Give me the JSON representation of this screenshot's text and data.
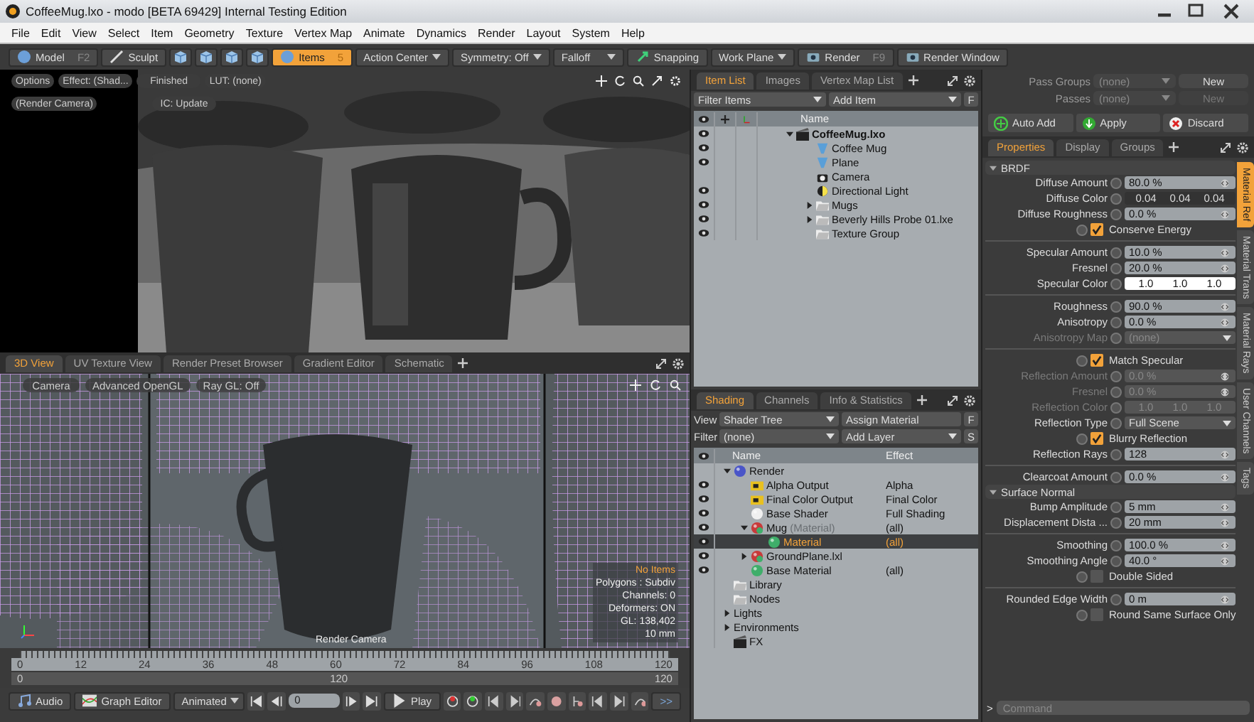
{
  "window": {
    "title": "CoffeeMug.lxo - modo [BETA 69429] Internal Testing Edition"
  },
  "menu": [
    "File",
    "Edit",
    "View",
    "Select",
    "Item",
    "Geometry",
    "Texture",
    "Vertex Map",
    "Animate",
    "Dynamics",
    "Render",
    "Layout",
    "System",
    "Help"
  ],
  "toolbar": [
    {
      "kind": "mode",
      "label": "Model",
      "shortcut": "F2",
      "selected": false
    },
    {
      "kind": "tool",
      "label": "Sculpt",
      "selected": false
    },
    {
      "kind": "cube",
      "selected": false
    },
    {
      "kind": "cube",
      "selected": false
    },
    {
      "kind": "cube",
      "selected": false
    },
    {
      "kind": "cube",
      "selected": false
    },
    {
      "kind": "mode",
      "label": "Items",
      "shortcut": "5",
      "selected": true
    },
    {
      "kind": "dropdown",
      "label": "Action Center",
      "selected": false
    },
    {
      "kind": "dropdown",
      "label": "Symmetry: Off",
      "selected": false
    },
    {
      "kind": "dropdown",
      "label": "Falloff",
      "selected": false
    },
    {
      "kind": "snap",
      "label": "Snapping",
      "selected": false
    },
    {
      "kind": "dropdown",
      "label": "Work Plane",
      "selected": false
    },
    {
      "kind": "render",
      "label": "Render",
      "shortcut": "F9",
      "selected": false
    },
    {
      "kind": "render",
      "label": "Render Window",
      "selected": false
    }
  ],
  "render_view": {
    "options": "Options",
    "effect": "Effect: (Shad...",
    "camera": "(Render Camera)",
    "status": "Finished",
    "update": "IC: Update",
    "lut": "LUT: (none)"
  },
  "viewport_tabs": [
    {
      "label": "3D View",
      "selected": true
    },
    {
      "label": "UV Texture View",
      "selected": false
    },
    {
      "label": "Render Preset Browser",
      "selected": false
    },
    {
      "label": "Gradient Editor",
      "selected": false
    },
    {
      "label": "Schematic",
      "selected": false
    }
  ],
  "viewport": {
    "buttons": [
      "Camera",
      "Advanced OpenGL",
      "Ray GL: Off"
    ],
    "selection": "No Items",
    "info": [
      "Polygons : Subdiv",
      "Channels: 0",
      "Deformers: ON",
      "GL: 138,402",
      "10 mm"
    ],
    "camera_label": "Render Camera"
  },
  "timeline": {
    "ticks": [
      "0",
      "12",
      "24",
      "36",
      "48",
      "60",
      "72",
      "84",
      "96",
      "108",
      "120"
    ],
    "start": "0",
    "length": "120",
    "end": "120"
  },
  "transport": {
    "audio": "Audio",
    "graph_editor": "Graph Editor",
    "mode": "Animated",
    "frame": "0",
    "play": "Play",
    "more": ">>"
  },
  "item_list": {
    "tabs": [
      {
        "label": "Item List",
        "selected": true
      },
      {
        "label": "Images",
        "selected": false
      },
      {
        "label": "Vertex Map List",
        "selected": false
      }
    ],
    "filter": "Filter Items",
    "add": "Add Item",
    "f_button": "F",
    "name_column": "Name",
    "tree": [
      {
        "name": "CoffeeMug.lxo",
        "kind": "scene",
        "visible": true,
        "expanded": true,
        "children": [
          {
            "name": "Coffee Mug",
            "kind": "mesh",
            "visible": true
          },
          {
            "name": "Plane",
            "kind": "mesh",
            "visible": true
          },
          {
            "name": "Camera",
            "kind": "camera",
            "visible": false
          },
          {
            "name": "Directional Light",
            "kind": "light",
            "visible": true
          },
          {
            "name": "Mugs",
            "kind": "group",
            "visible": true,
            "expanded": false
          },
          {
            "name": "Beverly Hills Probe 01.lxe",
            "kind": "group",
            "visible": true,
            "expanded": false
          },
          {
            "name": "Texture Group",
            "kind": "group",
            "visible": true
          }
        ]
      }
    ]
  },
  "shading": {
    "tabs": [
      {
        "label": "Shading",
        "selected": true
      },
      {
        "label": "Channels",
        "selected": false
      },
      {
        "label": "Info & Statistics",
        "selected": false
      }
    ],
    "view_label": "View",
    "view": "Shader Tree",
    "assign": "Assign Material",
    "f_button": "F",
    "filter_label": "Filter",
    "filter": "(none)",
    "add": "Add Layer",
    "s_button": "S",
    "columns": [
      "Name",
      "Effect"
    ],
    "tree": [
      {
        "name": "Render",
        "kind": "render",
        "visible": false,
        "selected": false,
        "expanded": true,
        "children": [
          {
            "name": "Alpha Output",
            "kind": "output",
            "effect": "Alpha",
            "visible": true,
            "selected": false
          },
          {
            "name": "Final Color Output",
            "kind": "output",
            "effect": "Final Color",
            "visible": true,
            "selected": false
          },
          {
            "name": "Base Shader",
            "kind": "shader",
            "effect": "Full Shading",
            "visible": true,
            "selected": false
          },
          {
            "name": "Mug",
            "type": "(Material)",
            "kind": "mask",
            "effect": "(all)",
            "visible": true,
            "selected": false,
            "expanded": true,
            "children": [
              {
                "name": "Material",
                "kind": "material",
                "effect": "(all)",
                "visible": true,
                "selected": true
              }
            ]
          },
          {
            "name": "GroundPlane.lxl",
            "kind": "mask",
            "visible": true,
            "selected": false,
            "expanded": false
          },
          {
            "name": "Base Material",
            "kind": "material",
            "effect": "(all)",
            "visible": true,
            "selected": false
          }
        ]
      },
      {
        "name": "Library",
        "kind": "folder",
        "visible": false,
        "selected": false
      },
      {
        "name": "Nodes",
        "kind": "folder",
        "visible": false,
        "selected": false
      },
      {
        "name": "Lights",
        "kind": "none",
        "visible": false,
        "selected": false,
        "expanded": false
      },
      {
        "name": "Environments",
        "kind": "none",
        "visible": false,
        "selected": false,
        "expanded": false
      },
      {
        "name": "FX",
        "kind": "fx",
        "visible": false,
        "selected": false
      }
    ]
  },
  "passes": [
    {
      "label": "Pass Groups",
      "value": "(none)",
      "button": "New",
      "disabled": false
    },
    {
      "label": "Passes",
      "value": "(none)",
      "button": "New",
      "disabled": true
    }
  ],
  "actions": [
    {
      "kind": "add",
      "label": "Auto Add"
    },
    {
      "kind": "apply",
      "label": "Apply"
    },
    {
      "kind": "discard",
      "label": "Discard"
    }
  ],
  "properties": {
    "tabs": [
      {
        "label": "Properties",
        "selected": true
      },
      {
        "label": "Display",
        "selected": false
      },
      {
        "label": "Groups",
        "selected": false
      }
    ],
    "side_tabs": [
      {
        "label": "Material Ref",
        "selected": true
      },
      {
        "label": "Material Trans",
        "selected": false
      },
      {
        "label": "Material Rays",
        "selected": false
      },
      {
        "label": "User Channels",
        "selected": false
      },
      {
        "label": "Tags",
        "selected": false
      }
    ],
    "rows": [
      {
        "kind": "section",
        "label": "BRDF",
        "expanded": true
      },
      {
        "kind": "slider",
        "label": "Diffuse Amount",
        "value": "80.0 %",
        "disabled": false
      },
      {
        "kind": "color",
        "label": "Diffuse Color",
        "values": [
          "0.04",
          "0.04",
          "0.04"
        ],
        "color": "#333333",
        "disabled": false
      },
      {
        "kind": "slider",
        "label": "Diffuse Roughness",
        "value": "0.0 %",
        "disabled": false
      },
      {
        "kind": "checkbox",
        "label": "Conserve Energy",
        "checked": true
      },
      {
        "kind": "divider"
      },
      {
        "kind": "slider",
        "label": "Specular Amount",
        "value": "10.0 %",
        "disabled": false
      },
      {
        "kind": "slider",
        "label": "Fresnel",
        "value": "20.0 %",
        "disabled": false
      },
      {
        "kind": "color",
        "label": "Specular Color",
        "values": [
          "1.0",
          "1.0",
          "1.0"
        ],
        "color": "#ffffff",
        "disabled": false
      },
      {
        "kind": "divider"
      },
      {
        "kind": "slider",
        "label": "Roughness",
        "value": "90.0 %",
        "disabled": false
      },
      {
        "kind": "slider",
        "label": "Anisotropy",
        "value": "0.0 %",
        "disabled": false
      },
      {
        "kind": "dropdown",
        "label": "Anisotropy Map",
        "value": "(none)",
        "disabled": true
      },
      {
        "kind": "divider"
      },
      {
        "kind": "checkbox",
        "label": "Match Specular",
        "checked": true
      },
      {
        "kind": "slider",
        "label": "Reflection Amount",
        "value": "0.0 %",
        "disabled": true
      },
      {
        "kind": "slider",
        "label": "Fresnel",
        "value": "0.0 %",
        "disabled": true
      },
      {
        "kind": "color",
        "label": "Reflection Color",
        "values": [
          "1.0",
          "1.0",
          "1.0"
        ],
        "disabled": true
      },
      {
        "kind": "dropdown",
        "label": "Reflection Type",
        "value": "Full Scene",
        "disabled": false
      },
      {
        "kind": "checkbox",
        "label": "Blurry Reflection",
        "checked": true
      },
      {
        "kind": "slider",
        "label": "Reflection Rays",
        "value": "128",
        "disabled": false
      },
      {
        "kind": "divider"
      },
      {
        "kind": "slider",
        "label": "Clearcoat Amount",
        "value": "0.0 %",
        "disabled": false
      },
      {
        "kind": "section",
        "label": "Surface Normal",
        "expanded": true
      },
      {
        "kind": "slider",
        "label": "Bump Amplitude",
        "value": "5 mm",
        "disabled": false
      },
      {
        "kind": "slider",
        "label": "Displacement Dista ...",
        "value": "20 mm",
        "disabled": false
      },
      {
        "kind": "divider"
      },
      {
        "kind": "slider",
        "label": "Smoothing",
        "value": "100.0 %",
        "disabled": false
      },
      {
        "kind": "slider",
        "label": "Smoothing Angle",
        "value": "40.0 °",
        "disabled": false
      },
      {
        "kind": "checkbox",
        "label": "Double Sided",
        "checked": false
      },
      {
        "kind": "divider"
      },
      {
        "kind": "slider",
        "label": "Rounded Edge Width",
        "value": "0 m",
        "disabled": false
      },
      {
        "kind": "checkbox",
        "label": "Round Same Surface Only",
        "checked": false
      }
    ]
  },
  "command": {
    "prompt": ">",
    "placeholder": "Command"
  }
}
